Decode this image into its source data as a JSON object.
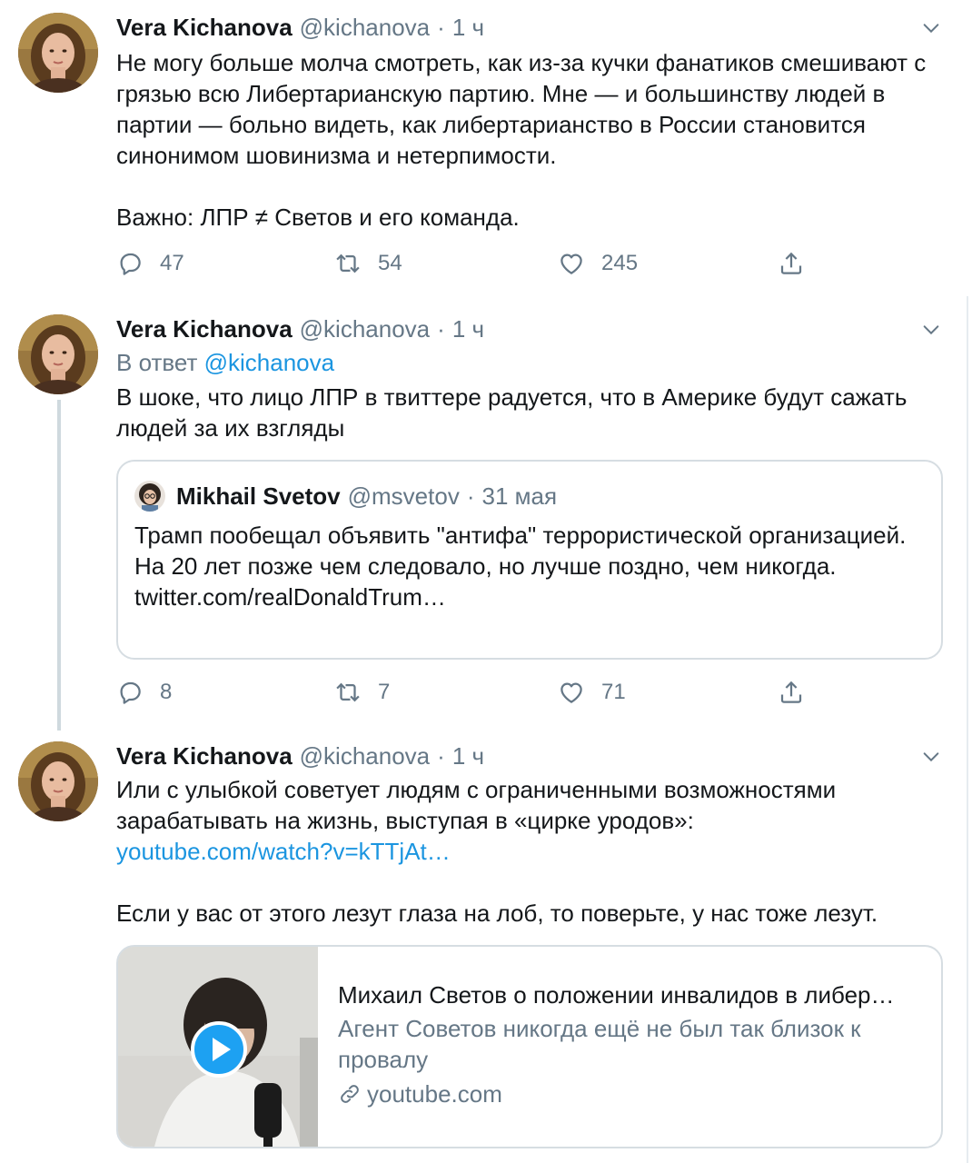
{
  "tweets": [
    {
      "name": "Vera Kichanova",
      "handle": "@kichanova",
      "sep": "·",
      "time": "1 ч",
      "paragraphs": [
        "Не могу больше молча смотреть, как из-за кучки фанатиков смешивают с грязью всю Либертарианскую партию. Мне — и большинству людей в партии — больно видеть, как либертарианство в России становится синонимом шовинизма и нетерпимости.",
        "Важно: ЛПР ≠ Светов и его команда."
      ],
      "replies": "47",
      "retweets": "54",
      "likes": "245"
    },
    {
      "name": "Vera Kichanova",
      "handle": "@kichanova",
      "sep": "·",
      "time": "1 ч",
      "reply_prefix": "В ответ",
      "reply_to": "@kichanova",
      "paragraphs": [
        "В шоке, что лицо ЛПР в твиттере радуется, что в Америке будут сажать людей за их взгляды"
      ],
      "quote": {
        "name": "Mikhail Svetov",
        "handle": "@msvetov",
        "sep": "·",
        "time": "31 мая",
        "text": "Трамп пообещал объявить \"антифа\" террористической организацией. На 20 лет позже чем следовало, но лучше поздно, чем никогда.",
        "link": "twitter.com/realDonaldTrum…"
      },
      "replies": "8",
      "retweets": "7",
      "likes": "71"
    },
    {
      "name": "Vera Kichanova",
      "handle": "@kichanova",
      "sep": "·",
      "time": "1 ч",
      "text_a": "Или с улыбкой советует людям с ограниченными возможностями зарабатывать на жизнь, выступая в «цирке уродов»:",
      "text_link": "youtube.com/watch?v=kTTjAt…",
      "text_b": "Если у вас от этого лезут глаза на лоб, то поверьте, у нас тоже лезут.",
      "card": {
        "title": "Михаил Светов о положении инвалидов в либер…",
        "description": "Агент Советов никогда ещё не был так близок к провалу",
        "domain": "youtube.com"
      }
    }
  ],
  "icons": {
    "reply": "speech-bubble-icon",
    "retweet": "retweet-icon",
    "like": "heart-icon",
    "share": "share-icon",
    "caret": "chevron-down-icon",
    "play": "play-icon",
    "link": "link-icon"
  },
  "colors": {
    "link": "#1b95e0",
    "secondary": "#657786",
    "border": "#d6dde2",
    "play": "#1da1f2"
  }
}
